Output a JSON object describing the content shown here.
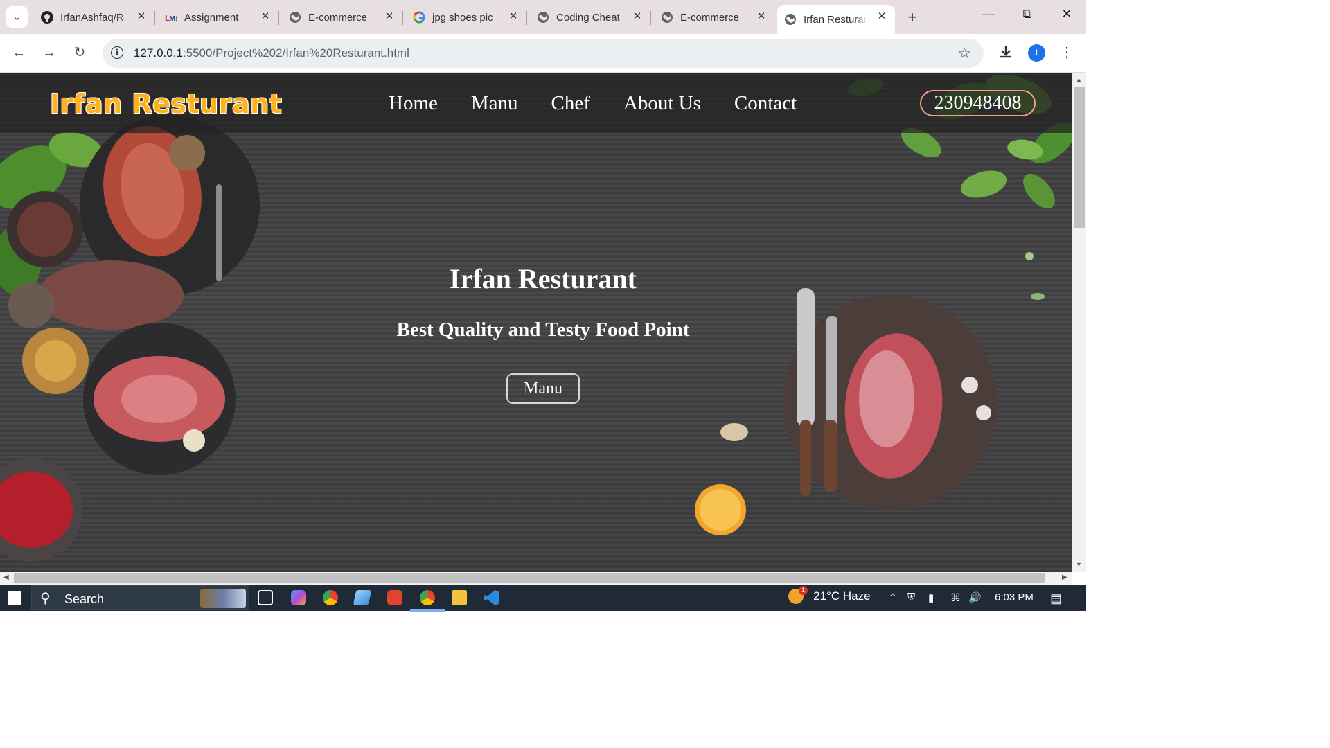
{
  "browser": {
    "tabs": [
      {
        "title": "IrfanAshfaq/R",
        "icon": "github-icon",
        "active": false
      },
      {
        "title": "Assignment",
        "icon": "lms-icon",
        "active": false
      },
      {
        "title": "E-commerce",
        "icon": "globe-icon",
        "active": false
      },
      {
        "title": "jpg shoes pic",
        "icon": "google-icon",
        "active": false
      },
      {
        "title": "Coding Cheat",
        "icon": "globe-icon",
        "active": false
      },
      {
        "title": "E-commerce",
        "icon": "globe-icon",
        "active": false
      },
      {
        "title": "Irfan Resturan",
        "icon": "globe-icon",
        "active": true
      }
    ],
    "url_host": "127.0.0.1",
    "url_path": ":5500/Project%202/Irfan%20Resturant.html",
    "profile_initial": "I"
  },
  "site": {
    "brand": "Irfan Resturant",
    "nav": [
      "Home",
      "Manu",
      "Chef",
      "About Us",
      "Contact"
    ],
    "phone": "230948408",
    "hero_title": "Irfan Resturant",
    "hero_subtitle": "Best Quality and Testy Food Point",
    "hero_button": "Manu"
  },
  "taskbar": {
    "search_label": "Search",
    "weather": "21°C  Haze",
    "weather_badge": "1",
    "time": "6:03 PM"
  },
  "colors": {
    "brand": "#ffb21a",
    "phone_border": "#f2a08c",
    "accent_blue": "#1a73e8"
  }
}
